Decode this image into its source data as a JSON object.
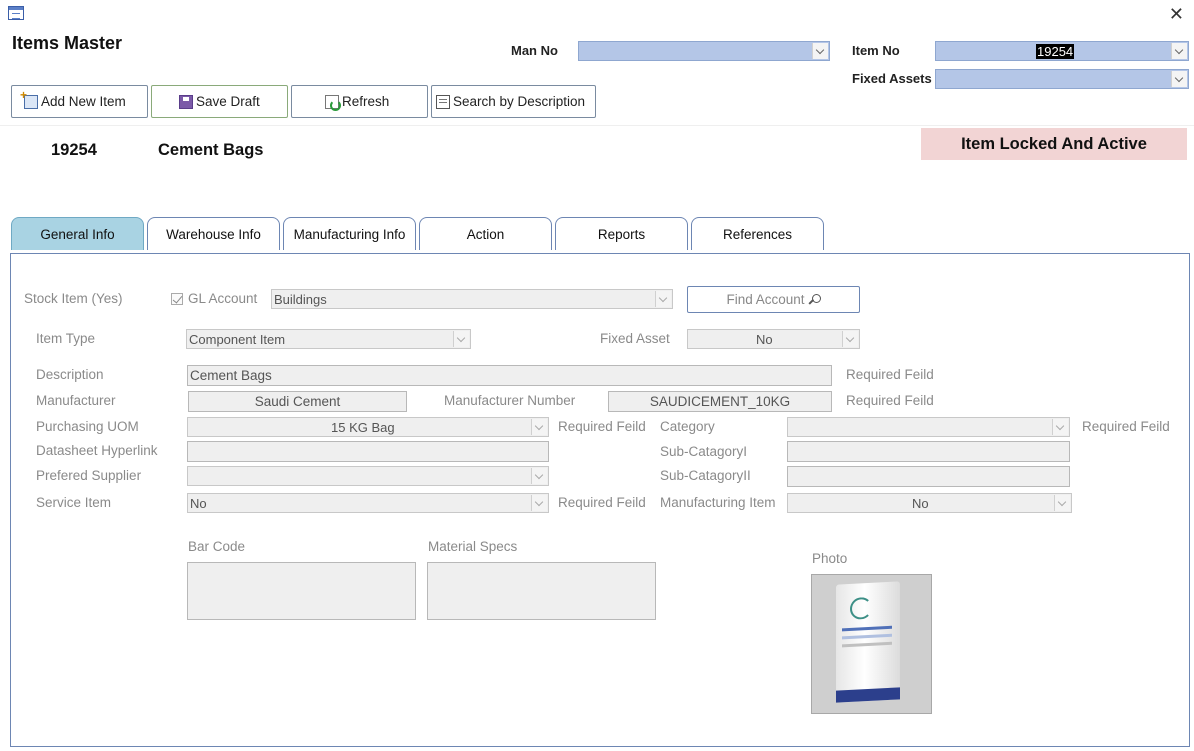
{
  "window": {
    "title": "Items Master"
  },
  "header": {
    "man_no_label": "Man No",
    "man_no_value": "",
    "item_no_label": "Item No",
    "item_no_value": "19254",
    "fixed_assets_label": "Fixed Assets",
    "fixed_assets_value": ""
  },
  "toolbar": {
    "add_new_item": "Add New Item",
    "save_draft": "Save Draft",
    "refresh": "Refresh",
    "search_by_description": "Search by Description"
  },
  "item": {
    "number": "19254",
    "name": "Cement Bags",
    "status": "Item Locked And Active"
  },
  "tabs": [
    {
      "label": "General Info",
      "active": true
    },
    {
      "label": "Warehouse Info",
      "active": false
    },
    {
      "label": "Manufacturing Info",
      "active": false
    },
    {
      "label": "Action",
      "active": false
    },
    {
      "label": "Reports",
      "active": false
    },
    {
      "label": "References",
      "active": false
    }
  ],
  "general": {
    "stock_item_label": "Stock Item (Yes)",
    "gl_account_label": "GL Account",
    "gl_account_value": "Buildings",
    "find_account": "Find Account",
    "item_type_label": "Item Type",
    "item_type_value": "Component Item",
    "fixed_asset_label": "Fixed Asset",
    "fixed_asset_value": "No",
    "description_label": "Description",
    "description_value": "Cement Bags",
    "manufacturer_label": "Manufacturer",
    "manufacturer_value": "Saudi Cement",
    "manufacturer_number_label": "Manufacturer Number",
    "manufacturer_number_value": "SAUDICEMENT_10KG",
    "purchasing_uom_label": "Purchasing UOM",
    "purchasing_uom_value": "15 KG Bag",
    "category_label": "Category",
    "category_value": "",
    "datasheet_label": "Datasheet Hyperlink",
    "datasheet_value": "",
    "sub_category1_label": "Sub-CatagoryI",
    "sub_category1_value": "",
    "preferred_supplier_label": "Prefered Supplier",
    "preferred_supplier_value": "",
    "sub_category2_label": "Sub-CatagoryII",
    "sub_category2_value": "",
    "service_item_label": "Service Item",
    "service_item_value": "No",
    "manufacturing_item_label": "Manufacturing Item",
    "manufacturing_item_value": "No",
    "required_field": "Required Feild",
    "bar_code_label": "Bar Code",
    "material_specs_label": "Material Specs",
    "photo_label": "Photo"
  },
  "icons": [
    "form-icon",
    "close-icon",
    "add-icon",
    "save-icon",
    "refresh-icon",
    "search-icon",
    "magnifier-icon",
    "chevron-down-icon",
    "checkbox-icon"
  ]
}
